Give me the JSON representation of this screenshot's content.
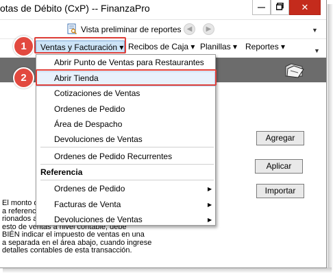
{
  "window": {
    "title": "otas de Débito (CxP) -- FinanzaPro",
    "minimize_glyph": "—",
    "maximize_glyph": "▢",
    "close_glyph": "✕"
  },
  "toolbar": {
    "preview_label": "Vista preliminar de reportes",
    "back_icon": "back-arrow-icon",
    "forward_icon": "forward-arrow-icon"
  },
  "menubar": {
    "items": [
      {
        "label": "Ventas y Facturación ▾"
      },
      {
        "label": "Recibos de Caja ▾"
      },
      {
        "label": "Planillas ▾"
      },
      {
        "label": "Reportes ▾"
      }
    ]
  },
  "dropdown": {
    "items": [
      {
        "label": "Abrir Punto de Ventas para Restaurantes"
      },
      {
        "label": "Abrir Tienda"
      },
      {
        "label": "Cotizaciones de Ventas"
      },
      {
        "label": "Ordenes de Pedido"
      },
      {
        "label": "Área de Despacho"
      },
      {
        "label": "Devoluciones de Ventas"
      },
      {
        "label": "Ordenes de Pedido Recurrentes"
      }
    ],
    "section_title": "Referencia",
    "submenus": [
      {
        "label": "Ordenes de Pedido"
      },
      {
        "label": "Facturas de Venta"
      },
      {
        "label": "Devoluciones de Ventas"
      }
    ],
    "submenu_arrow": "▶"
  },
  "buttons": {
    "agregar": "Agregar",
    "aplicar": "Aplicar",
    "importar": "Importar"
  },
  "body_text": "El monto d\na referenci\nrionados a\nesto de ventas a nivel contable, debe\nBIÉN indicar el impuesto de ventas en una\na separada en el área abajo, cuando ingrese\ndetalles contables de esta transacción.",
  "callouts": {
    "step1": "1",
    "step2": "2"
  },
  "colors": {
    "accent_red": "#e2493f",
    "menu_highlight": "#cde4f7",
    "banner": "#6c6c6c",
    "close_button": "#c42b1c"
  }
}
